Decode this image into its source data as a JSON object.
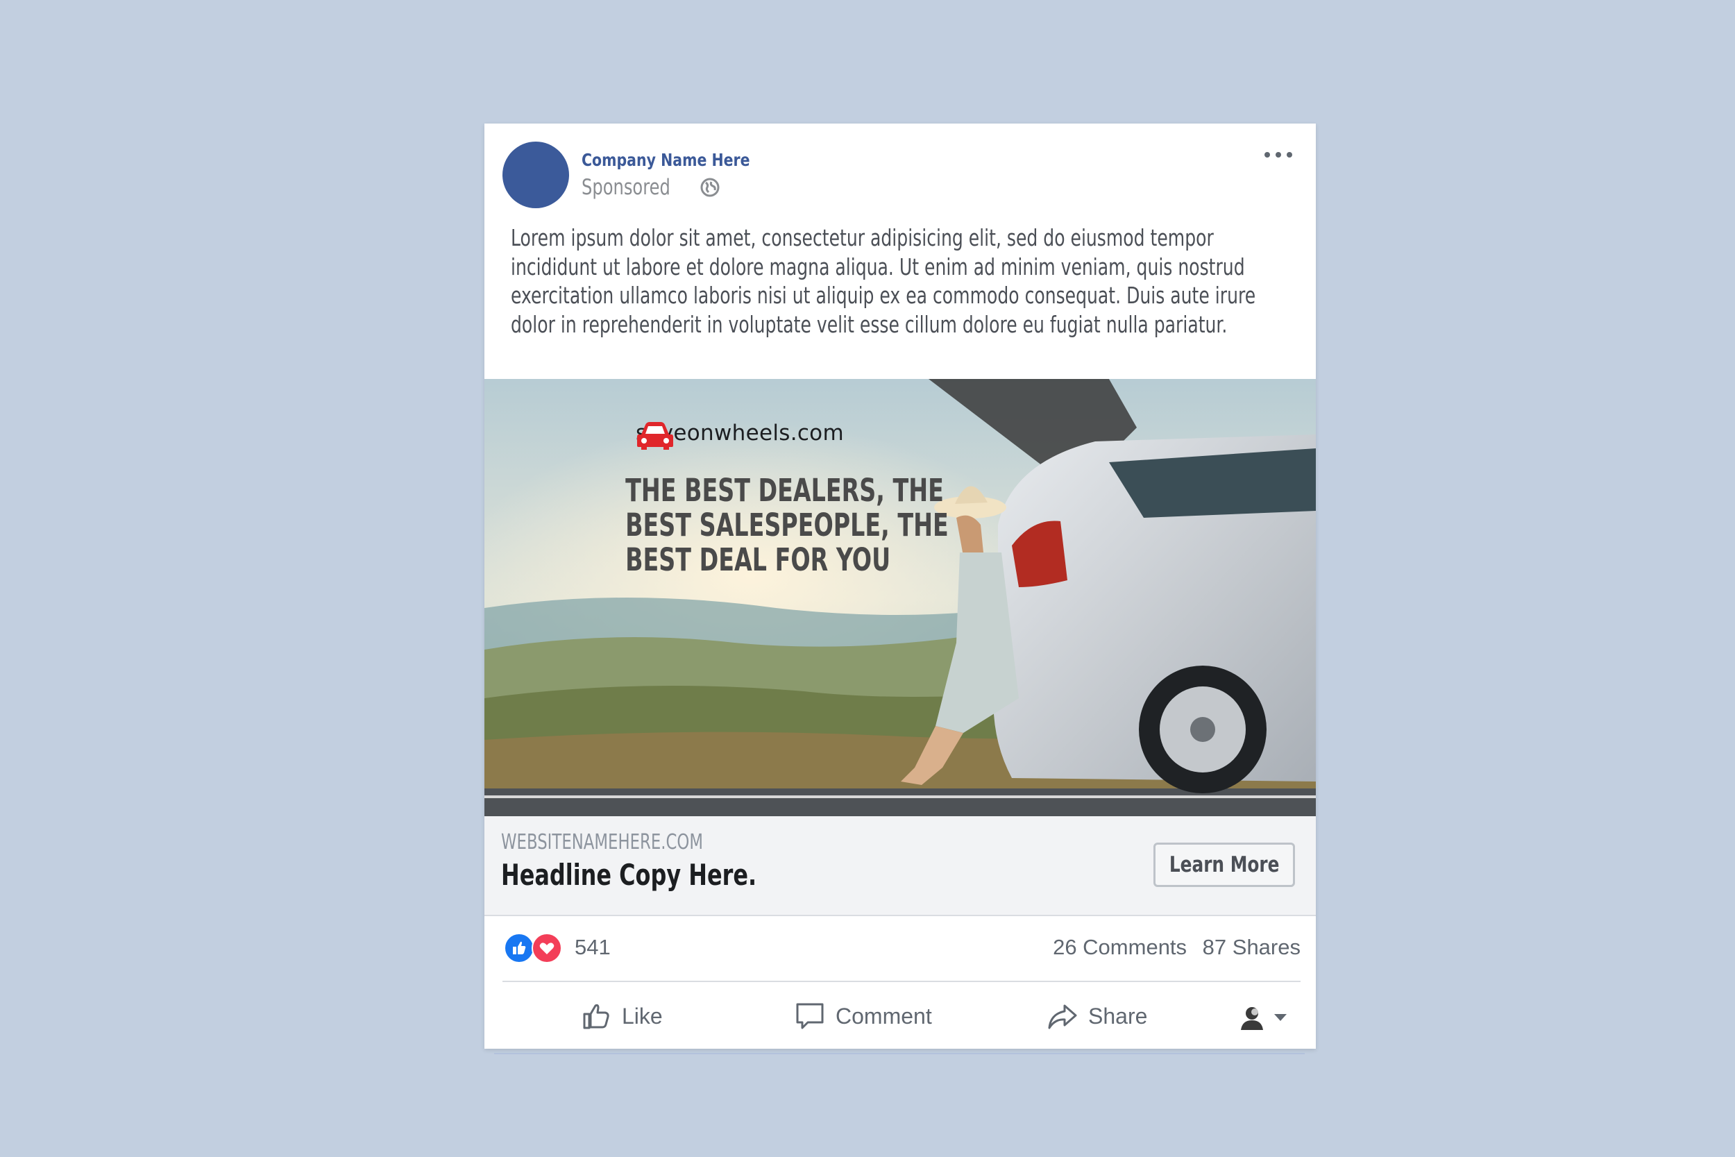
{
  "post": {
    "company_name": "Company Name Here",
    "sponsored_label": "Sponsored",
    "body_lines": [
      "Lorem ipsum dolor sit amet, consectetur adipisicing elit, sed do eiusmod tempor",
      "incididunt ut labore et dolore magna aliqua. Ut enim ad minim veniam, quis nostrud",
      "exercitation ullamco laboris nisi ut aliquip ex ea commodo consequat. Duis aute irure",
      "dolor in reprehenderit in voluptate velit esse cillum dolore eu fugiat nulla pariatur."
    ],
    "icons": {
      "privacy": "globe-icon",
      "menu": "more-options-icon"
    }
  },
  "ad": {
    "brand": "saveonwheels.com",
    "tagline_lines": [
      "THE BEST DEALERS, THE",
      "BEST SALESPEOPLE, THE",
      "BEST DEAL FOR YOU"
    ],
    "brand_color": "#e0262b"
  },
  "link_preview": {
    "site_url": "WEBSITENAMEHERE.COM",
    "headline": "Headline Copy Here.",
    "cta_label": "Learn More"
  },
  "engagement": {
    "reaction_count": "541",
    "comments": "26 Comments",
    "shares": "87 Shares",
    "reaction_icons": [
      "like-react-icon",
      "love-react-icon"
    ]
  },
  "actions": {
    "like": "Like",
    "comment": "Comment",
    "share": "Share"
  },
  "colors": {
    "background": "#c2cfe0",
    "brand_blue": "#3b5998",
    "like_blue": "#1877f2",
    "love_red": "#f33e58"
  }
}
